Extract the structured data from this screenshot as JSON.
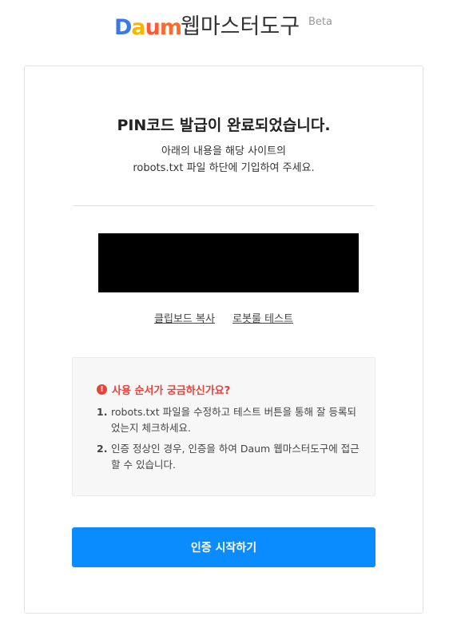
{
  "header": {
    "logo_parts": [
      "D",
      "a",
      "u",
      "m"
    ],
    "site_name": "웹마스터도구",
    "badge": "Beta"
  },
  "main": {
    "title": "PIN코드 발급이 완료되었습니다.",
    "description_line1": "아래의 내용을 해당 사이트의",
    "description_line2": "robots.txt 파일 하단에 기입하여 주세요.",
    "links": {
      "copy": "클립보드 복사",
      "test": "로봇룰 테스트"
    },
    "guide": {
      "title": "사용 순서가 궁금하신가요?",
      "icon": "exclamation-circle",
      "steps": [
        {
          "num": "1.",
          "text": "robots.txt 파일을 수정하고 테스트 버튼을 통해 잘 등록되었는지 체크하세요."
        },
        {
          "num": "2.",
          "text": "인증 정상인 경우, 인증을 하여 Daum 웹마스터도구에 접근할 수 있습니다."
        }
      ]
    },
    "start_button": "인증 시작하기"
  },
  "colors": {
    "accent": "#0a8cff",
    "warning": "#e8423b",
    "logo_blue": "#3b78e7",
    "logo_yellow": "#f7b500",
    "logo_red": "#ff5a36"
  }
}
